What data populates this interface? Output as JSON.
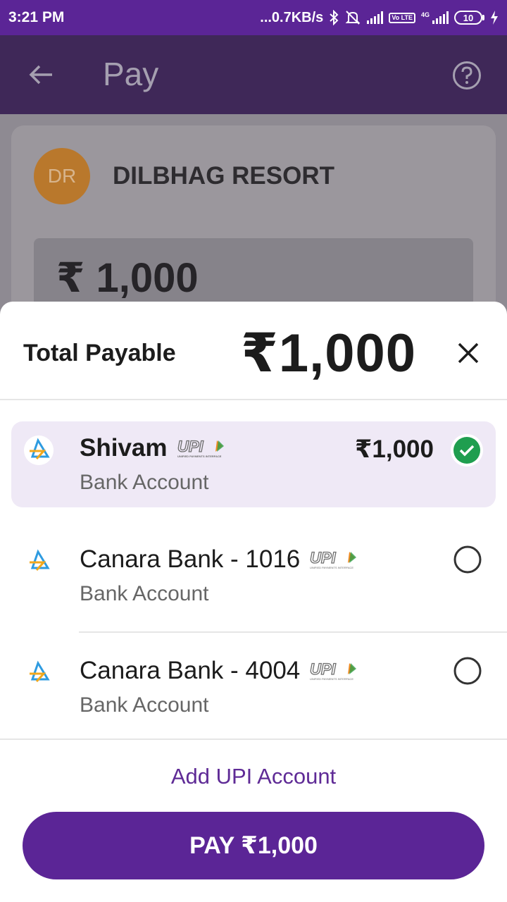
{
  "status_bar": {
    "time": "3:21 PM",
    "net_speed": "...0.7KB/s",
    "volte_label": "Vo LTE",
    "network_label": "4G",
    "battery_level": "10",
    "icons": [
      "bluetooth-icon",
      "mute-icon",
      "signal-icon",
      "volte-icon",
      "signal-4g-icon",
      "battery-icon",
      "charging-icon"
    ]
  },
  "toolbar": {
    "title": "Pay",
    "back_icon": "arrow-left-icon",
    "help_icon": "help-circle-icon"
  },
  "merchant": {
    "initials": "DR",
    "name": "DILBHAG RESORT",
    "amount": "₹ 1,000"
  },
  "sheet": {
    "total_label": "Total Payable",
    "total_amount": "₹1,000",
    "close_icon": "close-icon",
    "accounts": [
      {
        "name": "Shivam",
        "type": "Bank Account",
        "amount": "₹1,000",
        "selected": true
      },
      {
        "name": "Canara Bank - 1016",
        "type": "Bank Account",
        "selected": false
      },
      {
        "name": "Canara Bank - 4004",
        "type": "Bank Account",
        "selected": false
      }
    ],
    "upi_logo_text": "UPI",
    "upi_logo_subtext": "UNIFIED PAYMENTS INTERFACE",
    "add_account_label": "Add UPI Account",
    "pay_button_label": "PAY ₹1,000"
  },
  "colors": {
    "brand_purple": "#5b2596",
    "selected_bg": "#efe9f6",
    "check_green": "#1f9e4f"
  }
}
